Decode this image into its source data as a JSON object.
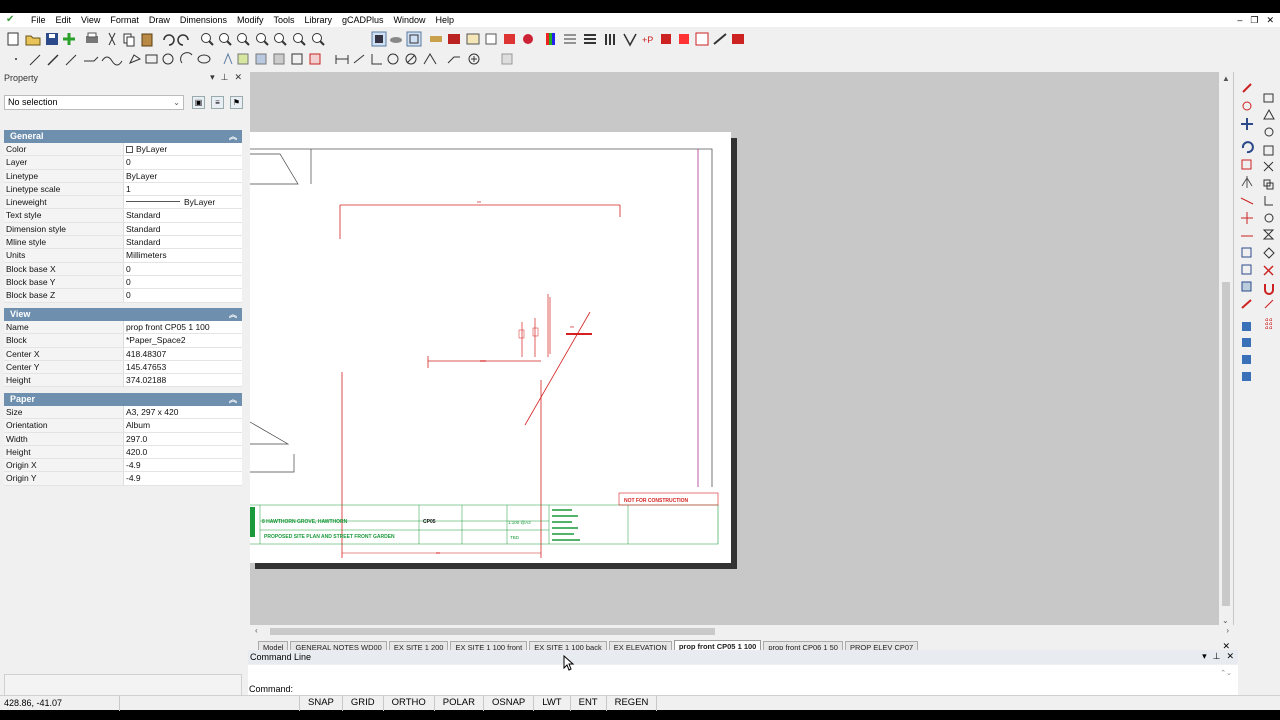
{
  "menu": [
    "File",
    "Edit",
    "View",
    "Format",
    "Draw",
    "Dimensions",
    "Modify",
    "Tools",
    "Library",
    "gCADPlus",
    "Window",
    "Help"
  ],
  "window_controls": [
    "–",
    "❐",
    "✕"
  ],
  "property_panel": {
    "title": "Property",
    "header_controls": [
      "▾",
      "⊥",
      "✕"
    ],
    "selection": "No selection",
    "sections": [
      {
        "name": "General",
        "rows": [
          {
            "key": "Color",
            "value": "ByLayer"
          },
          {
            "key": "Layer",
            "value": "0"
          },
          {
            "key": "Linetype",
            "value": "ByLayer"
          },
          {
            "key": "Linetype scale",
            "value": "1"
          },
          {
            "key": "Lineweight",
            "value": "ByLayer"
          },
          {
            "key": "Text style",
            "value": "Standard"
          },
          {
            "key": "Dimension style",
            "value": "Standard"
          },
          {
            "key": "Mline style",
            "value": "Standard"
          },
          {
            "key": "Units",
            "value": "Millimeters"
          },
          {
            "key": "Block base X",
            "value": "0"
          },
          {
            "key": "Block base Y",
            "value": "0"
          },
          {
            "key": "Block base Z",
            "value": "0"
          }
        ]
      },
      {
        "name": "View",
        "rows": [
          {
            "key": "Name",
            "value": "prop front CP05 1 100"
          },
          {
            "key": "Block",
            "value": "*Paper_Space2"
          },
          {
            "key": "Center X",
            "value": "418.48307"
          },
          {
            "key": "Center Y",
            "value": "145.47653"
          },
          {
            "key": "Height",
            "value": "374.02188"
          }
        ]
      },
      {
        "name": "Paper",
        "rows": [
          {
            "key": "Size",
            "value": "A3,  297 x 420"
          },
          {
            "key": "Orientation",
            "value": "Album"
          },
          {
            "key": "Width",
            "value": "297.0"
          },
          {
            "key": "Height",
            "value": "420.0"
          },
          {
            "key": "Origin X",
            "value": "-4.9"
          },
          {
            "key": "Origin Y",
            "value": "-4.9"
          }
        ]
      }
    ]
  },
  "drawing": {
    "title_block": {
      "address": "8 HAWTHORN GROVE, HAWTHORN",
      "drawing_title": "PROPOSED SITE PLAN AND STREET FRONT GARDEN",
      "drawing_no": "CP05",
      "scale": "1:100 @A3",
      "revision": "TBD",
      "status_stamp": "NOT FOR CONSTRUCTION"
    }
  },
  "tabs": {
    "items": [
      "Model",
      "GENERAL NOTES WD00",
      "EX SITE 1 200",
      "EX SITE 1 100 front",
      "EX SITE 1 100 back",
      "EX ELEVATION",
      "prop front CP05 1 100",
      "prop front CP06 1 50",
      "PROP ELEV CP07"
    ],
    "active_index": 6,
    "close": "✕"
  },
  "command_line": {
    "title": "Command Line",
    "header_controls": [
      "▾",
      "⊥",
      "✕"
    ],
    "prompt": "Command:"
  },
  "status_bar": {
    "coords": "428.86, -41.07",
    "buttons": [
      "SNAP",
      "GRID",
      "ORTHO",
      "POLAR",
      "OSNAP",
      "LWT",
      "ENT",
      "REGEN"
    ]
  },
  "colors": {
    "accent_section": "#6e8fae",
    "drawing_red": "#d42020",
    "drawing_green": "#1a9a3a",
    "drawing_magenta": "#b03090",
    "canvas_bg": "#c8c8c8"
  }
}
